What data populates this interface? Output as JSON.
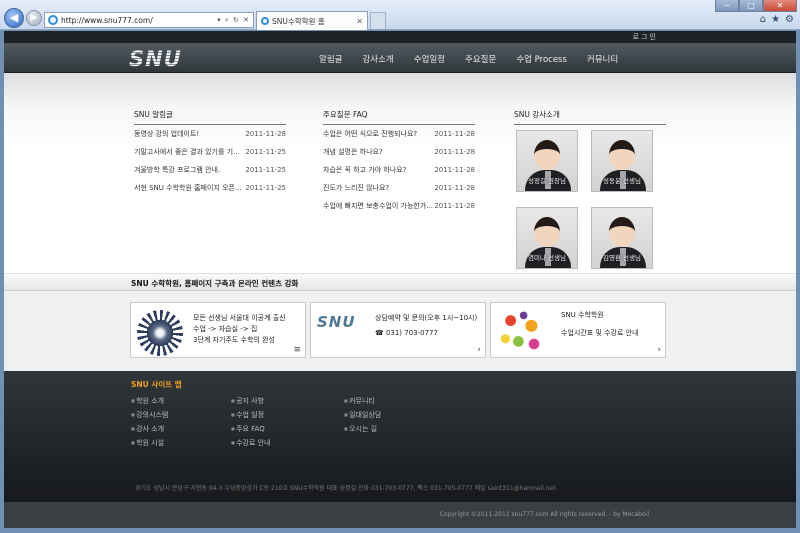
{
  "browser": {
    "url": "http://www.snu777.com/",
    "addr_tools": "▾ ⌕ ↻ ✕",
    "tab_title": "SNU수학학원 홈",
    "back": "◀",
    "forward": "▶",
    "tab_close": "✕",
    "win_min": "─",
    "win_max": "□",
    "win_close": "✕",
    "home": "⌂",
    "star": "★",
    "gear": "⚙"
  },
  "header": {
    "login": "로그인",
    "logo": "SNU",
    "nav": [
      "알림글",
      "강사소개",
      "수업일정",
      "주요질문",
      "수업 Process",
      "커뮤니티"
    ]
  },
  "notice": {
    "title": "SNU 알림글",
    "items": [
      {
        "text": "동영상 강의 업데이트!",
        "date": "2011-11-28"
      },
      {
        "text": "기말고사에서 좋은 결과 있기를 기...",
        "date": "2011-11-25"
      },
      {
        "text": "겨울방학 특강 프로그램 안내.",
        "date": "2011-11-25"
      },
      {
        "text": "서현 SNU 수학학원 홈페이지 오픈...",
        "date": "2011-11-25"
      }
    ]
  },
  "faq": {
    "title": "주요질문 FAQ",
    "items": [
      {
        "text": "수업은 어떤 식으로 진행되나요?",
        "date": "2011-11-28"
      },
      {
        "text": "개념 설명은 하나요?",
        "date": "2011-11-28"
      },
      {
        "text": "자습은 꼭 하고 가야 하나요?",
        "date": "2011-11-28"
      },
      {
        "text": "진도가 느리진 않나요?",
        "date": "2011-11-28"
      },
      {
        "text": "수업에 빠지면 보충수업이 가능한가...",
        "date": "2011-11-28"
      }
    ]
  },
  "teachers": {
    "title": "SNU 강사소개",
    "names": [
      "성정길 원장님",
      "성동윤 선생님",
      "염미나 선생님",
      "김영환 선생님"
    ]
  },
  "strip": {
    "text": "SNU 수학학원, 홈페이지 구축과 온라인 컨텐츠 강화"
  },
  "boxes": {
    "b1": [
      "모든 선생님 서울대 이공계 출신",
      "수업 -> 자습실 -> 집",
      "3단계 자기주도 수학의 완성"
    ],
    "b2_logo": "SNU",
    "b2": [
      "상담예약 및 문의(오후 1시~10시)",
      "☎ 031) 703-0777"
    ],
    "b3": [
      "SNU 수학학원",
      "수업시간표 및 수강료 안내"
    ],
    "menu_icon": "≡",
    "arrow": "›"
  },
  "footer": {
    "sitemap_title": "SNU 사이트 맵",
    "col1": [
      "학원 소개",
      "강의시스템",
      "강사 소개",
      "학원 시설"
    ],
    "col2": [
      "공지 사항",
      "수업 일정",
      "주요 FAQ",
      "수강료 안내"
    ],
    "col3": [
      "커뮤니티",
      "일대일상담",
      "오시는 길"
    ],
    "address": "경기도 성남시 분당구 서현동 94-3 우성중앙상가 C동 210호 SNU수학학원 대표 성정길 전화 031-703-0777, 팩스 031-705-0777 메일 saint311@hanmail.net",
    "copyright": "Copyright ©2011-2011 snu777.com All rights reserved. - by Mecaboil"
  }
}
